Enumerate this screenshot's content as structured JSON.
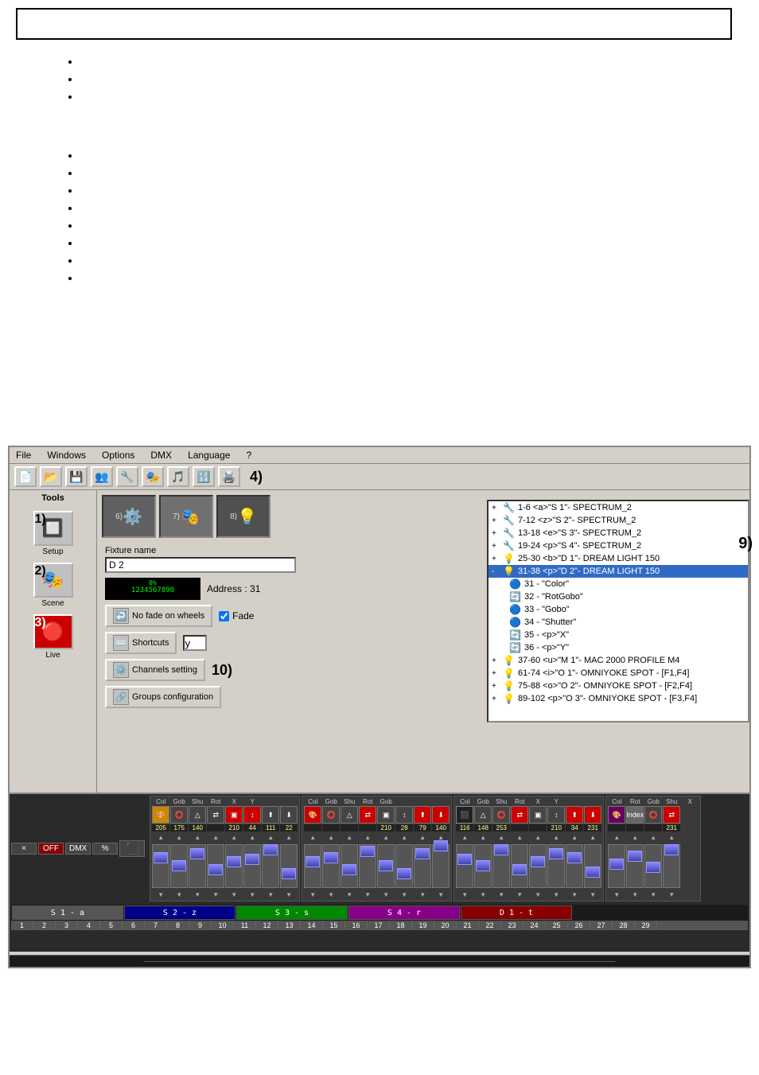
{
  "document": {
    "border_box": "",
    "bullet_sections": [
      {
        "items": [
          "",
          "",
          ""
        ]
      },
      {
        "items": [
          "",
          "",
          "",
          "",
          "",
          "",
          "",
          ""
        ]
      }
    ]
  },
  "menu": {
    "items": [
      "File",
      "Windows",
      "Options",
      "DMX",
      "Language",
      "?"
    ]
  },
  "toolbar": {
    "buttons": [
      "📄",
      "📂",
      "💾",
      "👥",
      "🔧",
      "🎭",
      "🎵",
      "🔢",
      "🖨️"
    ],
    "label": "4)"
  },
  "left_panel": {
    "title": "Tools",
    "items": [
      {
        "number": "1)",
        "icon": "🔲",
        "label": "Setup"
      },
      {
        "number": "2)",
        "icon": "🎭",
        "label": "Scene"
      },
      {
        "number": "3)",
        "icon": "🔴",
        "label": "Live"
      }
    ]
  },
  "center_panel": {
    "image_labels": [
      "6)",
      "7)",
      "8)"
    ],
    "fixture_name_label": "Fixture name",
    "fixture_name_value": "D 2",
    "address_label": "Address : 31",
    "dmx_line1": "0%",
    "dmx_line2": "1234567890",
    "no_fade_label": "No fade on wheels",
    "fade_label": "Fade",
    "shortcuts_label": "Shortcuts",
    "shortcuts_value": "y",
    "channels_label": "Channels setting",
    "groups_label": "Groups configuration",
    "section_number": "10)"
  },
  "right_panel": {
    "section_number": "9)",
    "items": [
      {
        "id": "1-6",
        "prefix": "<a>",
        "name": "\"S 1\"- SPECTRUM_2",
        "expanded": false,
        "indent": 0
      },
      {
        "id": "7-12",
        "prefix": "<z>",
        "name": "\"S 2\"- SPECTRUM_2",
        "expanded": false,
        "indent": 0
      },
      {
        "id": "13-18",
        "prefix": "<e>",
        "name": "\"S 3\"- SPECTRUM_2",
        "expanded": false,
        "indent": 0
      },
      {
        "id": "19-24",
        "prefix": "<p>",
        "name": "\"S 4\"- SPECTRUM_2",
        "expanded": false,
        "indent": 0
      },
      {
        "id": "25-30",
        "prefix": "<b>",
        "name": "\"D 1\"- DREAM LIGHT 150",
        "expanded": false,
        "indent": 0
      },
      {
        "id": "31-38",
        "prefix": "<p>",
        "name": "\"D 2\"- DREAM LIGHT 150",
        "expanded": true,
        "selected": true,
        "indent": 0
      },
      {
        "id": "31",
        "name": "- \"Color\"",
        "indent": 1
      },
      {
        "id": "32",
        "name": "- \"RotGobo\"",
        "indent": 1
      },
      {
        "id": "33",
        "name": "- \"Gobo\"",
        "indent": 1
      },
      {
        "id": "34",
        "name": "- \"Shutter\"",
        "indent": 1
      },
      {
        "id": "35",
        "name": "- <p>\"X\"",
        "indent": 1
      },
      {
        "id": "36",
        "name": "- <p>\"Y\"",
        "indent": 1
      },
      {
        "id": "37-60",
        "prefix": "<u>",
        "name": "\"M 1\"- MAC 2000 PROFILE M4",
        "expanded": false,
        "indent": 0
      },
      {
        "id": "61-74",
        "prefix": "<i>",
        "name": "\"O 1\"- OMNIYOKE SPOT - [F1,F4]",
        "expanded": false,
        "indent": 0
      },
      {
        "id": "75-88",
        "prefix": "<o>",
        "name": "\"O 2\"- OMNIYOKE SPOT - [F2,F4]",
        "expanded": false,
        "indent": 0
      },
      {
        "id": "89-102",
        "prefix": "<p>",
        "name": "\"O 3\"- OMNIYOKE SPOT - [F3,F4]",
        "expanded": false,
        "indent": 0
      }
    ]
  },
  "bottom_area": {
    "ctrl_buttons": [
      "×",
      "OFF",
      "DMX",
      "%",
      "⬛"
    ],
    "fader_groups": [
      {
        "headers": [
          "Col",
          "Gob",
          "Shu",
          "Rot",
          "X",
          "Y"
        ],
        "values": [
          "205",
          "175",
          "140",
          "",
          "210",
          "44",
          "111",
          "22"
        ],
        "color": "orange",
        "fader_positions": [
          40,
          55,
          35,
          60,
          45,
          50
        ]
      },
      {
        "headers": [
          "Col",
          "Gob",
          "Shu",
          "Rot",
          "Gob"
        ],
        "values": [
          "",
          "",
          "",
          "",
          "210",
          "28",
          "79",
          "140",
          "",
          "210"
        ],
        "color": "red",
        "fader_positions": [
          50,
          40,
          60,
          35,
          45
        ]
      },
      {
        "headers": [
          "Col",
          "Gob",
          "Shu",
          "Rot",
          "X",
          "Y"
        ],
        "values": [
          "116",
          "148",
          "253",
          "",
          "",
          "210",
          "34",
          "",
          "231"
        ],
        "color": "blue",
        "fader_positions": [
          45,
          55,
          65,
          40,
          50,
          55
        ]
      },
      {
        "headers": [
          "Col",
          "Rot",
          "Gob",
          "Shu",
          "X"
        ],
        "values": [
          "",
          "",
          "",
          "",
          ""
        ],
        "color": "purple",
        "fader_positions": [
          50,
          45,
          55,
          40,
          60
        ]
      }
    ],
    "scene_labels": [
      {
        "text": "S 1 - a",
        "class": "s1"
      },
      {
        "text": "S 2 - z",
        "class": "s2"
      },
      {
        "text": "S 3 - s",
        "class": "s3"
      },
      {
        "text": "S 4 - r",
        "class": "s4"
      },
      {
        "text": "D 1 - t",
        "class": "d1"
      }
    ],
    "ch_numbers": [
      "1",
      "2",
      "3",
      "4",
      "5",
      "6",
      "7",
      "8",
      "9",
      "10",
      "11",
      "12",
      "13",
      "14",
      "15",
      "16",
      "17",
      "18",
      "19",
      "20",
      "21",
      "22",
      "23",
      "24",
      "25",
      "26",
      "27",
      "28",
      "29"
    ]
  }
}
